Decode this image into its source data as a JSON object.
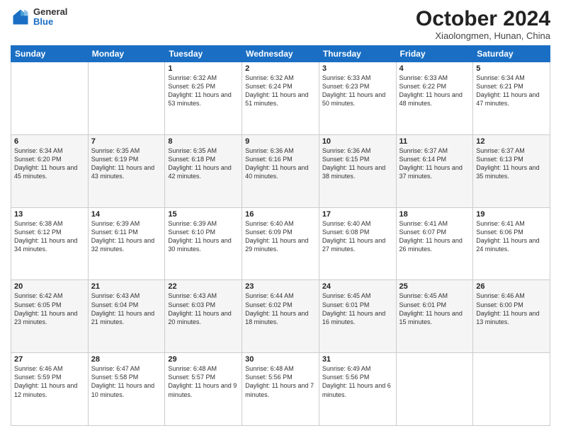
{
  "logo": {
    "general": "General",
    "blue": "Blue"
  },
  "header": {
    "title": "October 2024",
    "location": "Xiaolongmen, Hunan, China"
  },
  "days_of_week": [
    "Sunday",
    "Monday",
    "Tuesday",
    "Wednesday",
    "Thursday",
    "Friday",
    "Saturday"
  ],
  "weeks": [
    [
      {
        "day": "",
        "sunrise": "",
        "sunset": "",
        "daylight": ""
      },
      {
        "day": "",
        "sunrise": "",
        "sunset": "",
        "daylight": ""
      },
      {
        "day": "1",
        "sunrise": "Sunrise: 6:32 AM",
        "sunset": "Sunset: 6:25 PM",
        "daylight": "Daylight: 11 hours and 53 minutes."
      },
      {
        "day": "2",
        "sunrise": "Sunrise: 6:32 AM",
        "sunset": "Sunset: 6:24 PM",
        "daylight": "Daylight: 11 hours and 51 minutes."
      },
      {
        "day": "3",
        "sunrise": "Sunrise: 6:33 AM",
        "sunset": "Sunset: 6:23 PM",
        "daylight": "Daylight: 11 hours and 50 minutes."
      },
      {
        "day": "4",
        "sunrise": "Sunrise: 6:33 AM",
        "sunset": "Sunset: 6:22 PM",
        "daylight": "Daylight: 11 hours and 48 minutes."
      },
      {
        "day": "5",
        "sunrise": "Sunrise: 6:34 AM",
        "sunset": "Sunset: 6:21 PM",
        "daylight": "Daylight: 11 hours and 47 minutes."
      }
    ],
    [
      {
        "day": "6",
        "sunrise": "Sunrise: 6:34 AM",
        "sunset": "Sunset: 6:20 PM",
        "daylight": "Daylight: 11 hours and 45 minutes."
      },
      {
        "day": "7",
        "sunrise": "Sunrise: 6:35 AM",
        "sunset": "Sunset: 6:19 PM",
        "daylight": "Daylight: 11 hours and 43 minutes."
      },
      {
        "day": "8",
        "sunrise": "Sunrise: 6:35 AM",
        "sunset": "Sunset: 6:18 PM",
        "daylight": "Daylight: 11 hours and 42 minutes."
      },
      {
        "day": "9",
        "sunrise": "Sunrise: 6:36 AM",
        "sunset": "Sunset: 6:16 PM",
        "daylight": "Daylight: 11 hours and 40 minutes."
      },
      {
        "day": "10",
        "sunrise": "Sunrise: 6:36 AM",
        "sunset": "Sunset: 6:15 PM",
        "daylight": "Daylight: 11 hours and 38 minutes."
      },
      {
        "day": "11",
        "sunrise": "Sunrise: 6:37 AM",
        "sunset": "Sunset: 6:14 PM",
        "daylight": "Daylight: 11 hours and 37 minutes."
      },
      {
        "day": "12",
        "sunrise": "Sunrise: 6:37 AM",
        "sunset": "Sunset: 6:13 PM",
        "daylight": "Daylight: 11 hours and 35 minutes."
      }
    ],
    [
      {
        "day": "13",
        "sunrise": "Sunrise: 6:38 AM",
        "sunset": "Sunset: 6:12 PM",
        "daylight": "Daylight: 11 hours and 34 minutes."
      },
      {
        "day": "14",
        "sunrise": "Sunrise: 6:39 AM",
        "sunset": "Sunset: 6:11 PM",
        "daylight": "Daylight: 11 hours and 32 minutes."
      },
      {
        "day": "15",
        "sunrise": "Sunrise: 6:39 AM",
        "sunset": "Sunset: 6:10 PM",
        "daylight": "Daylight: 11 hours and 30 minutes."
      },
      {
        "day": "16",
        "sunrise": "Sunrise: 6:40 AM",
        "sunset": "Sunset: 6:09 PM",
        "daylight": "Daylight: 11 hours and 29 minutes."
      },
      {
        "day": "17",
        "sunrise": "Sunrise: 6:40 AM",
        "sunset": "Sunset: 6:08 PM",
        "daylight": "Daylight: 11 hours and 27 minutes."
      },
      {
        "day": "18",
        "sunrise": "Sunrise: 6:41 AM",
        "sunset": "Sunset: 6:07 PM",
        "daylight": "Daylight: 11 hours and 26 minutes."
      },
      {
        "day": "19",
        "sunrise": "Sunrise: 6:41 AM",
        "sunset": "Sunset: 6:06 PM",
        "daylight": "Daylight: 11 hours and 24 minutes."
      }
    ],
    [
      {
        "day": "20",
        "sunrise": "Sunrise: 6:42 AM",
        "sunset": "Sunset: 6:05 PM",
        "daylight": "Daylight: 11 hours and 23 minutes."
      },
      {
        "day": "21",
        "sunrise": "Sunrise: 6:43 AM",
        "sunset": "Sunset: 6:04 PM",
        "daylight": "Daylight: 11 hours and 21 minutes."
      },
      {
        "day": "22",
        "sunrise": "Sunrise: 6:43 AM",
        "sunset": "Sunset: 6:03 PM",
        "daylight": "Daylight: 11 hours and 20 minutes."
      },
      {
        "day": "23",
        "sunrise": "Sunrise: 6:44 AM",
        "sunset": "Sunset: 6:02 PM",
        "daylight": "Daylight: 11 hours and 18 minutes."
      },
      {
        "day": "24",
        "sunrise": "Sunrise: 6:45 AM",
        "sunset": "Sunset: 6:01 PM",
        "daylight": "Daylight: 11 hours and 16 minutes."
      },
      {
        "day": "25",
        "sunrise": "Sunrise: 6:45 AM",
        "sunset": "Sunset: 6:01 PM",
        "daylight": "Daylight: 11 hours and 15 minutes."
      },
      {
        "day": "26",
        "sunrise": "Sunrise: 6:46 AM",
        "sunset": "Sunset: 6:00 PM",
        "daylight": "Daylight: 11 hours and 13 minutes."
      }
    ],
    [
      {
        "day": "27",
        "sunrise": "Sunrise: 6:46 AM",
        "sunset": "Sunset: 5:59 PM",
        "daylight": "Daylight: 11 hours and 12 minutes."
      },
      {
        "day": "28",
        "sunrise": "Sunrise: 6:47 AM",
        "sunset": "Sunset: 5:58 PM",
        "daylight": "Daylight: 11 hours and 10 minutes."
      },
      {
        "day": "29",
        "sunrise": "Sunrise: 6:48 AM",
        "sunset": "Sunset: 5:57 PM",
        "daylight": "Daylight: 11 hours and 9 minutes."
      },
      {
        "day": "30",
        "sunrise": "Sunrise: 6:48 AM",
        "sunset": "Sunset: 5:56 PM",
        "daylight": "Daylight: 11 hours and 7 minutes."
      },
      {
        "day": "31",
        "sunrise": "Sunrise: 6:49 AM",
        "sunset": "Sunset: 5:56 PM",
        "daylight": "Daylight: 11 hours and 6 minutes."
      },
      {
        "day": "",
        "sunrise": "",
        "sunset": "",
        "daylight": ""
      },
      {
        "day": "",
        "sunrise": "",
        "sunset": "",
        "daylight": ""
      }
    ]
  ]
}
